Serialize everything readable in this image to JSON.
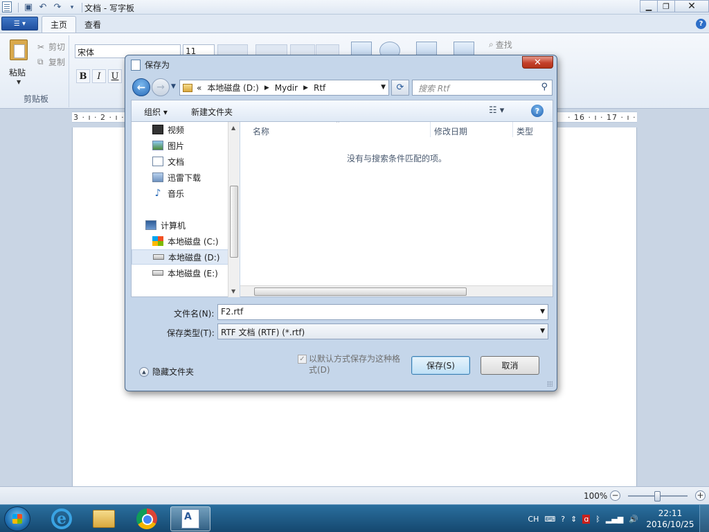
{
  "window": {
    "title": "文档 - 写字板",
    "tabs": [
      "主页",
      "查看"
    ]
  },
  "ribbon": {
    "paste_label": "粘贴",
    "cut_label": "剪切",
    "copy_label": "复制",
    "clipboard_group": "剪贴板",
    "font_name": "宋体",
    "font_size": "11",
    "bold": "B",
    "italic": "I",
    "underline": "U",
    "find_label": "查找"
  },
  "ruler": {
    "left_marks": "3 · ı · 2 · ı · 1",
    "right_marks": "· 16 · ı · 17 · ı · 18 ·"
  },
  "dialog": {
    "title": "保存为",
    "close": "✕",
    "address": {
      "prefix": "«",
      "crumbs": [
        "本地磁盘 (D:)",
        "Mydir",
        "Rtf"
      ]
    },
    "search_placeholder": "搜索 Rtf",
    "toolbar": {
      "organize": "组织 ▾",
      "new_folder": "新建文件夹"
    },
    "nav_items": [
      {
        "label": "视频",
        "icon": "video-icon"
      },
      {
        "label": "图片",
        "icon": "pictures-icon"
      },
      {
        "label": "文档",
        "icon": "documents-icon"
      },
      {
        "label": "迅雷下载",
        "icon": "download-icon"
      },
      {
        "label": "音乐",
        "icon": "music-icon"
      },
      {
        "label": "计算机",
        "icon": "computer-icon"
      },
      {
        "label": "本地磁盘 (C:)",
        "icon": "drive-c-icon"
      },
      {
        "label": "本地磁盘 (D:)",
        "icon": "drive-icon",
        "selected": true
      },
      {
        "label": "本地磁盘 (E:)",
        "icon": "drive-icon"
      }
    ],
    "columns": [
      "名称",
      "修改日期",
      "类型"
    ],
    "empty_message": "没有与搜索条件匹配的项。",
    "filename_label": "文件名(N):",
    "filename_value": "F2.rtf",
    "filetype_label": "保存类型(T):",
    "filetype_value": "RTF 文档 (RTF) (*.rtf)",
    "hide_folders": "隐藏文件夹",
    "default_format_line1": "以默认方式保存为这种格",
    "default_format_line2": "式(D)",
    "save_button": "保存(S)",
    "cancel_button": "取消"
  },
  "statusbar": {
    "zoom": "100%"
  },
  "taskbar": {
    "tray_lang": "CH",
    "time": "22:11",
    "date": "2016/10/25"
  }
}
